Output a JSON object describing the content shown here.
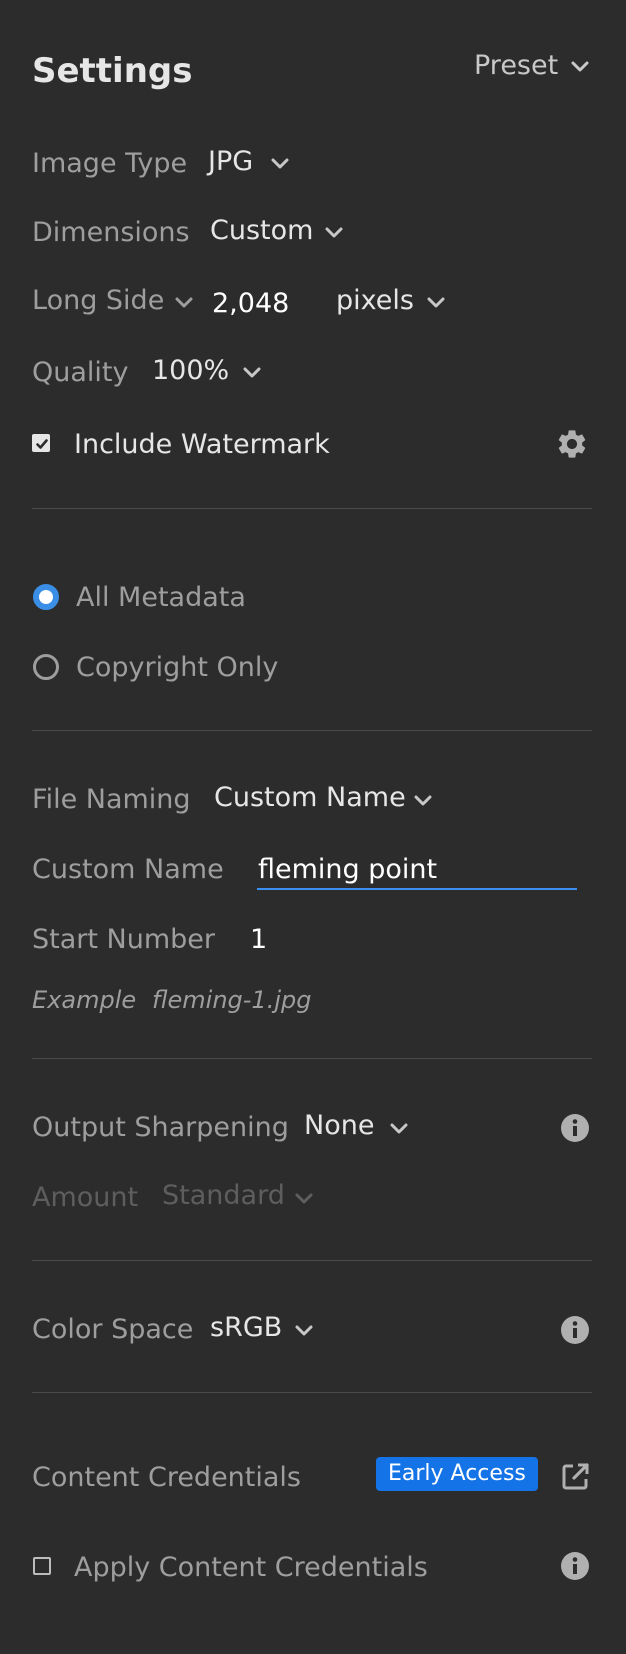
{
  "header": {
    "title": "Settings",
    "preset_label": "Preset"
  },
  "image_type": {
    "label": "Image Type",
    "value": "JPG"
  },
  "dimensions": {
    "label": "Dimensions",
    "value": "Custom"
  },
  "long_side": {
    "label": "Long Side",
    "value": "2,048",
    "unit": "pixels"
  },
  "quality": {
    "label": "Quality",
    "value": "100%"
  },
  "watermark": {
    "label": "Include Watermark",
    "checked": true
  },
  "metadata": {
    "options": [
      {
        "label": "All Metadata",
        "selected": true
      },
      {
        "label": "Copyright Only",
        "selected": false
      }
    ]
  },
  "file_naming": {
    "label": "File Naming",
    "value": "Custom Name"
  },
  "custom_name": {
    "label": "Custom Name",
    "value": "fleming point"
  },
  "start_number": {
    "label": "Start Number",
    "value": "1"
  },
  "example": {
    "label": "Example",
    "value": "fleming-1.jpg"
  },
  "sharpening": {
    "label": "Output Sharpening",
    "value": "None"
  },
  "amount": {
    "label": "Amount",
    "value": "Standard"
  },
  "color_space": {
    "label": "Color Space",
    "value": "sRGB"
  },
  "content_credentials": {
    "label": "Content Credentials",
    "badge": "Early Access",
    "apply_label": "Apply Content Credentials",
    "apply_checked": false
  },
  "colors": {
    "accent": "#1473e6",
    "radio": "#3a8ee6",
    "underline": "#3b8ff0",
    "background": "#2c2c2c"
  },
  "icons": [
    "chevron-down-icon",
    "gear-icon",
    "info-icon",
    "external-link-icon",
    "checkbox-icon",
    "radio-icon"
  ]
}
